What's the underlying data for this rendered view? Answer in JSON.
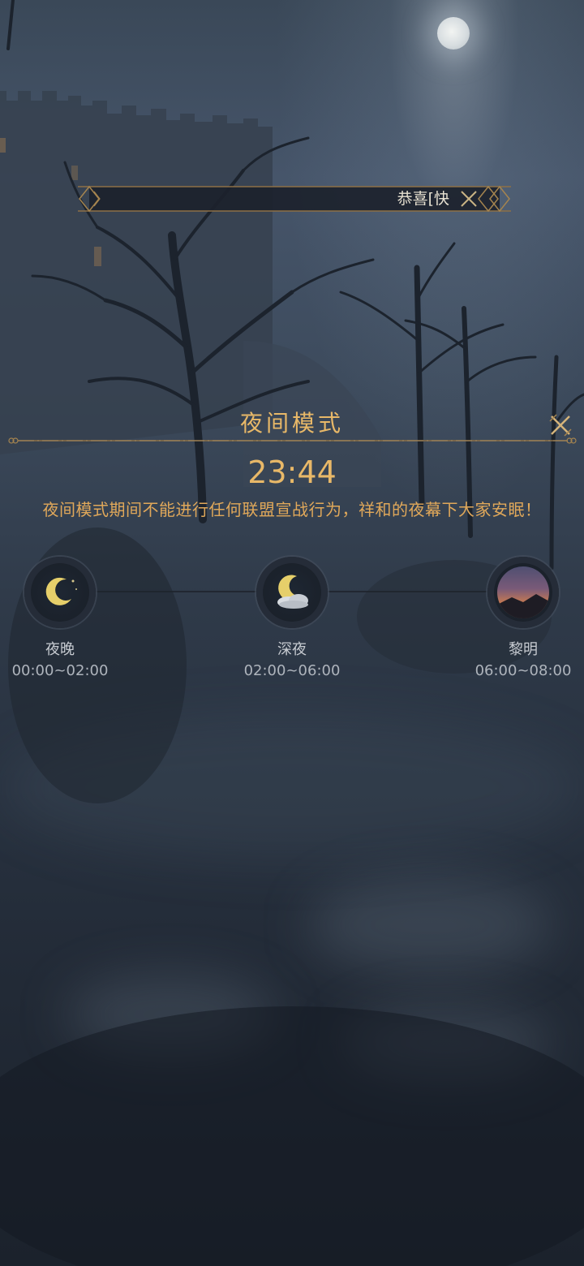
{
  "marquee": {
    "text": "恭喜[快"
  },
  "panel": {
    "title": "夜间模式",
    "clock": "23:44",
    "description": "夜间模式期间不能进行任何联盟宣战行为，祥和的夜幕下大家安眠！"
  },
  "phases": [
    {
      "name": "夜晚",
      "time": "00:00~02:00",
      "icon": "crescent-moon-icon"
    },
    {
      "name": "深夜",
      "time": "02:00~06:00",
      "icon": "moon-cloud-icon"
    },
    {
      "name": "黎明",
      "time": "06:00~08:00",
      "icon": "dawn-sky-icon"
    }
  ],
  "colors": {
    "accent_gold": "#e8b868",
    "description_gold": "#e0a85a",
    "phase_text": "#c8ccd2"
  }
}
